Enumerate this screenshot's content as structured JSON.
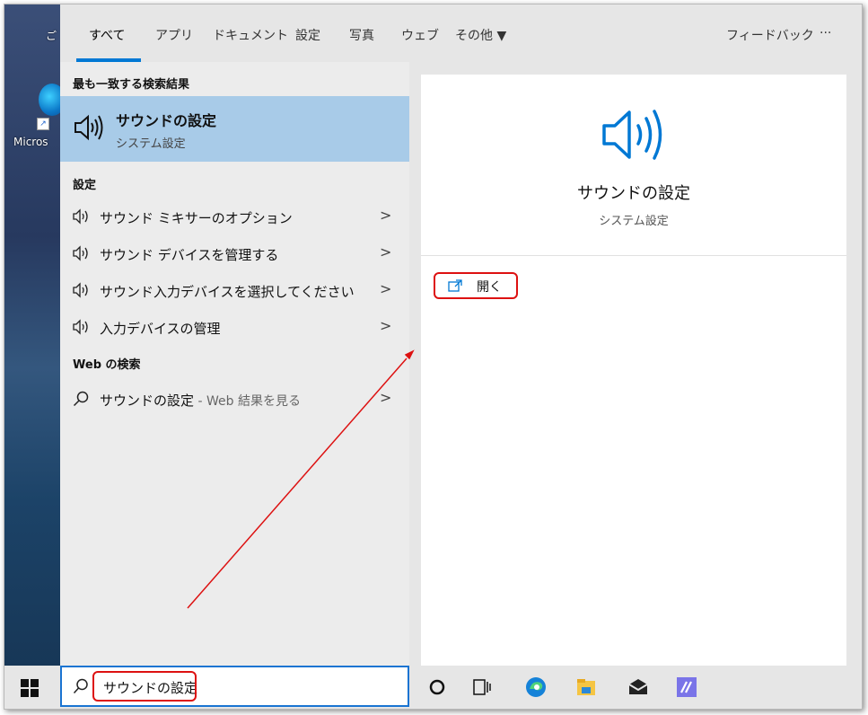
{
  "desktop": {
    "top_label": "ご",
    "icon_label": "Micros"
  },
  "tabs": {
    "items": [
      {
        "label": "すべて",
        "active": true
      },
      {
        "label": "アプリ"
      },
      {
        "label": "ドキュメント"
      },
      {
        "label": "設定"
      },
      {
        "label": "写真"
      },
      {
        "label": "ウェブ"
      },
      {
        "label": "その他 ▼"
      }
    ],
    "feedback": "フィードバック",
    "more": "···"
  },
  "results": {
    "best_match_header": "最も一致する検索結果",
    "best_match": {
      "title": "サウンドの設定",
      "subtitle": "システム設定",
      "icon": "speaker-icon"
    },
    "settings_header": "設定",
    "settings_items": [
      {
        "label": "サウンド ミキサーのオプション",
        "icon": "speaker-icon"
      },
      {
        "label": "サウンド デバイスを管理する",
        "icon": "speaker-icon"
      },
      {
        "label": "サウンド入力デバイスを選択してください",
        "icon": "speaker-icon"
      },
      {
        "label": "入力デバイスの管理",
        "icon": "speaker-icon"
      }
    ],
    "web_header": "Web の検索",
    "web_item": {
      "label": "サウンドの設定",
      "suffix": " - Web 結果を見る",
      "icon": "search-icon"
    }
  },
  "detail": {
    "title": "サウンドの設定",
    "subtitle": "システム設定",
    "open_label": "開く",
    "icon": "speaker-icon"
  },
  "taskbar": {
    "search_value": "サウンドの設定",
    "icons": [
      "windows-logo-icon",
      "cortana-icon",
      "task-view-icon",
      "edge-icon",
      "file-explorer-icon",
      "mail-icon",
      "app-icon"
    ]
  },
  "colors": {
    "accent": "#0078d4",
    "selection": "#a8cbe8",
    "annotation": "#dd1111"
  }
}
